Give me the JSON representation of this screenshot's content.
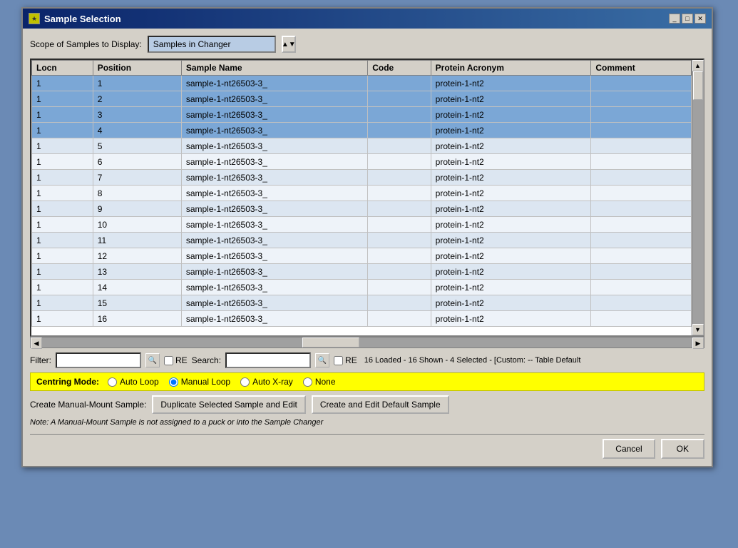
{
  "dialog": {
    "title": "Sample Selection",
    "icon": "★",
    "scope_label": "Scope of Samples to Display:",
    "scope_value": "Samples in Changer",
    "columns": [
      "Locn",
      "Position",
      "Sample Name",
      "Code",
      "Protein Acronym",
      "Comment"
    ],
    "rows": [
      {
        "locn": "1",
        "position": "1",
        "name": "sample-1-nt26503-3_",
        "code": "",
        "protein": "protein-1-nt2",
        "comment": "",
        "selected": true
      },
      {
        "locn": "1",
        "position": "2",
        "name": "sample-1-nt26503-3_",
        "code": "",
        "protein": "protein-1-nt2",
        "comment": "",
        "selected": true
      },
      {
        "locn": "1",
        "position": "3",
        "name": "sample-1-nt26503-3_",
        "code": "",
        "protein": "protein-1-nt2",
        "comment": "",
        "selected": true
      },
      {
        "locn": "1",
        "position": "4",
        "name": "sample-1-nt26503-3_",
        "code": "",
        "protein": "protein-1-nt2",
        "comment": "",
        "selected": true
      },
      {
        "locn": "1",
        "position": "5",
        "name": "sample-1-nt26503-3_",
        "code": "",
        "protein": "protein-1-nt2",
        "comment": "",
        "selected": false
      },
      {
        "locn": "1",
        "position": "6",
        "name": "sample-1-nt26503-3_",
        "code": "",
        "protein": "protein-1-nt2",
        "comment": "",
        "selected": false
      },
      {
        "locn": "1",
        "position": "7",
        "name": "sample-1-nt26503-3_",
        "code": "",
        "protein": "protein-1-nt2",
        "comment": "",
        "selected": false
      },
      {
        "locn": "1",
        "position": "8",
        "name": "sample-1-nt26503-3_",
        "code": "",
        "protein": "protein-1-nt2",
        "comment": "",
        "selected": false
      },
      {
        "locn": "1",
        "position": "9",
        "name": "sample-1-nt26503-3_",
        "code": "",
        "protein": "protein-1-nt2",
        "comment": "",
        "selected": false
      },
      {
        "locn": "1",
        "position": "10",
        "name": "sample-1-nt26503-3_",
        "code": "",
        "protein": "protein-1-nt2",
        "comment": "",
        "selected": false
      },
      {
        "locn": "1",
        "position": "11",
        "name": "sample-1-nt26503-3_",
        "code": "",
        "protein": "protein-1-nt2",
        "comment": "",
        "selected": false
      },
      {
        "locn": "1",
        "position": "12",
        "name": "sample-1-nt26503-3_",
        "code": "",
        "protein": "protein-1-nt2",
        "comment": "",
        "selected": false
      },
      {
        "locn": "1",
        "position": "13",
        "name": "sample-1-nt26503-3_",
        "code": "",
        "protein": "protein-1-nt2",
        "comment": "",
        "selected": false
      },
      {
        "locn": "1",
        "position": "14",
        "name": "sample-1-nt26503-3_",
        "code": "",
        "protein": "protein-1-nt2",
        "comment": "",
        "selected": false
      },
      {
        "locn": "1",
        "position": "15",
        "name": "sample-1-nt26503-3_",
        "code": "",
        "protein": "protein-1-nt2",
        "comment": "",
        "selected": false
      },
      {
        "locn": "1",
        "position": "16",
        "name": "sample-1-nt26503-3_",
        "code": "",
        "protein": "protein-1-nt2",
        "comment": "",
        "selected": false
      }
    ],
    "status": "16 Loaded - 16 Shown - 4 Selected - [Custom: -- Table Default",
    "filter_label": "Filter:",
    "search_label": "Search:",
    "re_label": "RE",
    "centring_label": "Centring Mode:",
    "centring_options": [
      {
        "label": "Auto Loop",
        "value": "auto_loop"
      },
      {
        "label": "Manual Loop",
        "value": "manual_loop",
        "selected": true
      },
      {
        "label": "Auto X-ray",
        "value": "auto_xray"
      },
      {
        "label": "None",
        "value": "none"
      }
    ],
    "manual_mount_label": "Create Manual-Mount Sample:",
    "duplicate_btn": "Duplicate Selected Sample and Edit",
    "create_default_btn": "Create and Edit Default Sample",
    "note_text": "Note: A Manual-Mount Sample is not assigned to a puck or into the Sample Changer",
    "cancel_btn": "Cancel",
    "ok_btn": "OK"
  }
}
